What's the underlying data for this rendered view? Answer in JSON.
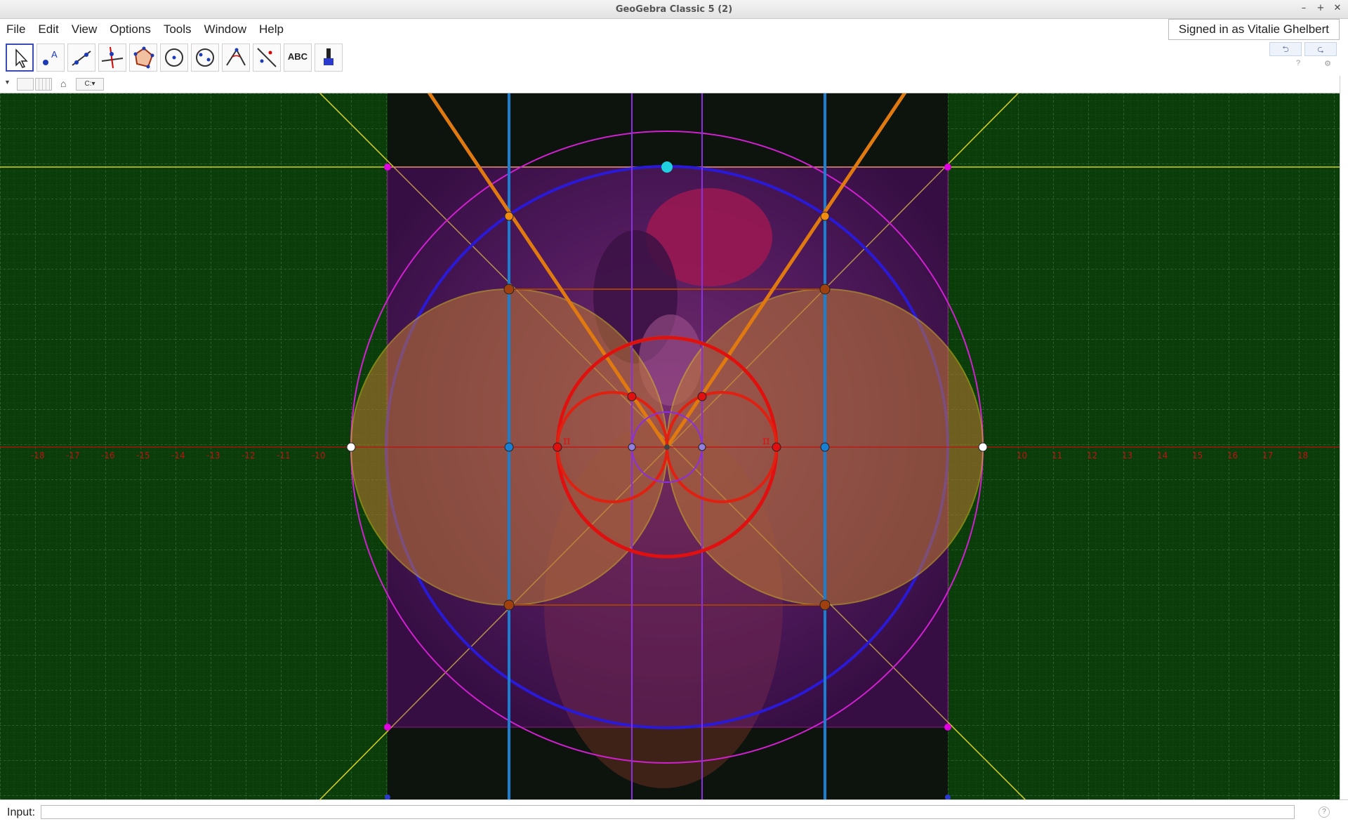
{
  "window": {
    "title": "GeoGebra Classic 5 (2)"
  },
  "menu": [
    "File",
    "Edit",
    "View",
    "Options",
    "Tools",
    "Window",
    "Help"
  ],
  "account": {
    "signed_in_label": "Signed in as Vitalie Ghelbert"
  },
  "toolbar": {
    "tools": [
      {
        "name": "move-tool",
        "icon": "arrow-cursor-icon"
      },
      {
        "name": "point-tool",
        "icon": "point-icon",
        "glyph": "A"
      },
      {
        "name": "line-tool",
        "icon": "line-icon"
      },
      {
        "name": "perpendicular-line-tool",
        "icon": "perpendicular-icon"
      },
      {
        "name": "polygon-tool",
        "icon": "polygon-icon"
      },
      {
        "name": "circle-center-point-tool",
        "icon": "circle-icon"
      },
      {
        "name": "circle-through-points-tool",
        "icon": "circle-points-icon"
      },
      {
        "name": "angle-tool",
        "icon": "angle-icon"
      },
      {
        "name": "reflect-tool",
        "icon": "reflect-icon"
      },
      {
        "name": "text-tool",
        "icon": "text-icon",
        "glyph": "ABC"
      },
      {
        "name": "move-graphics-view-tool",
        "icon": "pen-icon"
      }
    ],
    "undo_symbol": "⮌",
    "redo_symbol": "⮎",
    "help_glyph": "?",
    "settings_glyph": "⚙"
  },
  "stylebar": {
    "axes_toggle": "",
    "grid_toggle": "",
    "home_glyph": "⌂",
    "color_dropdown": "C:▾"
  },
  "graphics": {
    "background_color": "#0b3d0b",
    "axis_color": "#c01010",
    "x_axis_ticks_left": [
      "-18",
      "-17",
      "-16",
      "-15",
      "-14",
      "-13",
      "-12",
      "-11",
      "-10"
    ],
    "x_axis_ticks_right": [
      "10",
      "11",
      "12",
      "13",
      "14",
      "15",
      "16",
      "17",
      "18"
    ],
    "pi_labels": [
      "π",
      "π"
    ],
    "point_colors": {
      "magenta": "#e000e0",
      "orange": "#f08a10",
      "brown": "#a0400e",
      "blue": "#1a7fd0",
      "red": "#e01010",
      "cyan": "#20d0e0",
      "white": "#ffffff"
    }
  },
  "input_bar": {
    "label": "Input:",
    "value": "",
    "help_glyph": "?"
  }
}
